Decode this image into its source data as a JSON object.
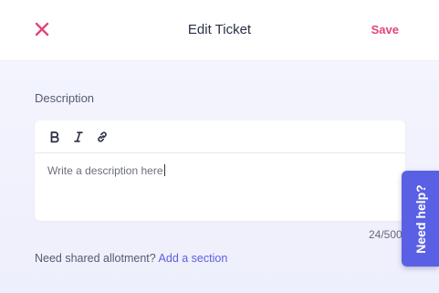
{
  "header": {
    "title": "Edit Ticket",
    "save_label": "Save",
    "close_icon": "close-icon",
    "accent_color": "#e0457b"
  },
  "description": {
    "label": "Description",
    "toolbar": [
      "bold-icon",
      "italic-icon",
      "link-icon"
    ],
    "placeholder": "Write a description here",
    "counter": "24/500"
  },
  "footer": {
    "question": "Need shared allotment?",
    "link": "Add a section",
    "link_color": "#5b5fe0"
  },
  "help": {
    "label": "Need help?",
    "color": "#5a60e3"
  }
}
